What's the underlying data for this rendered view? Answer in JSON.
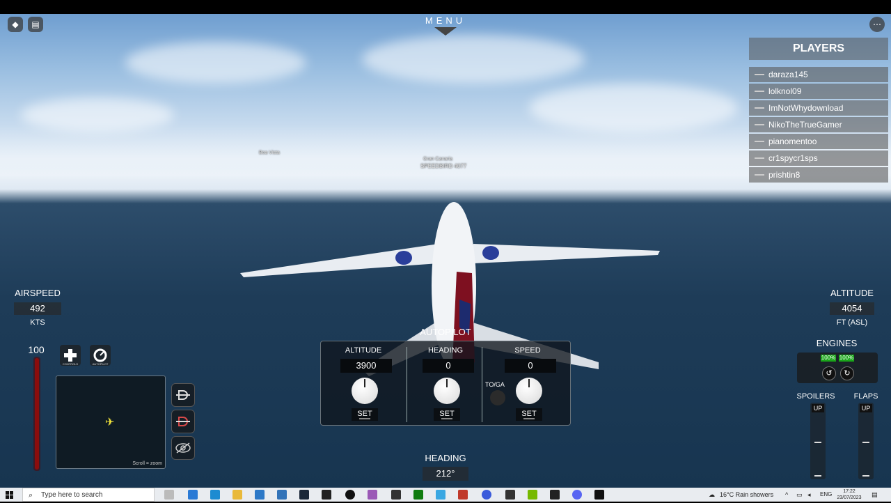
{
  "hud": {
    "menu_label": "MENU",
    "world_labels": {
      "left": "Boa Vista",
      "center_name": "Gran Canaria",
      "center_info": "SPEEDBIRD 4077"
    },
    "airspeed": {
      "label": "AIRSPEED",
      "value": "492",
      "unit": "KTS"
    },
    "altitude": {
      "label": "ALTITUDE",
      "value": "4054",
      "unit": "FT (ASL)"
    },
    "throttle": {
      "value": "100",
      "fraction": 1.0
    },
    "controls_label": "CONTROLS",
    "autopilot_btn_label": "AUTOPILOT",
    "minimap_hint": "Scroll = zoom",
    "heading": {
      "label": "HEADING",
      "value": "212°"
    },
    "engines": {
      "label": "ENGINES",
      "left_pct": "100%",
      "right_pct": "100%"
    },
    "spoilers": {
      "label": "SPOILERS",
      "state": "UP"
    },
    "flaps": {
      "label": "FLAPS",
      "state": "UP"
    }
  },
  "autopilot": {
    "title": "AUTOPILOT",
    "altitude": {
      "label": "ALTITUDE",
      "value": "3900",
      "set": "SET"
    },
    "heading": {
      "label": "HEADING",
      "value": "0",
      "set": "SET"
    },
    "speed": {
      "label": "SPEED",
      "value": "0",
      "set": "SET"
    },
    "toga_label": "TO/GA"
  },
  "players": {
    "title": "PLAYERS",
    "list": [
      "daraza145",
      "lolknol09",
      "ImNotWhydownload",
      "NikoTheTrueGamer",
      "pianomentoo",
      "cr1spycr1sps",
      "prishtin8"
    ]
  },
  "taskbar": {
    "search_placeholder": "Type here to search",
    "weather": "16°C  Rain showers",
    "lang": "ENG",
    "time": "17:22",
    "date": "23/07/2023"
  },
  "colors": {
    "throttle": "#8b0d0d",
    "engine_ok": "#1aa51a"
  }
}
